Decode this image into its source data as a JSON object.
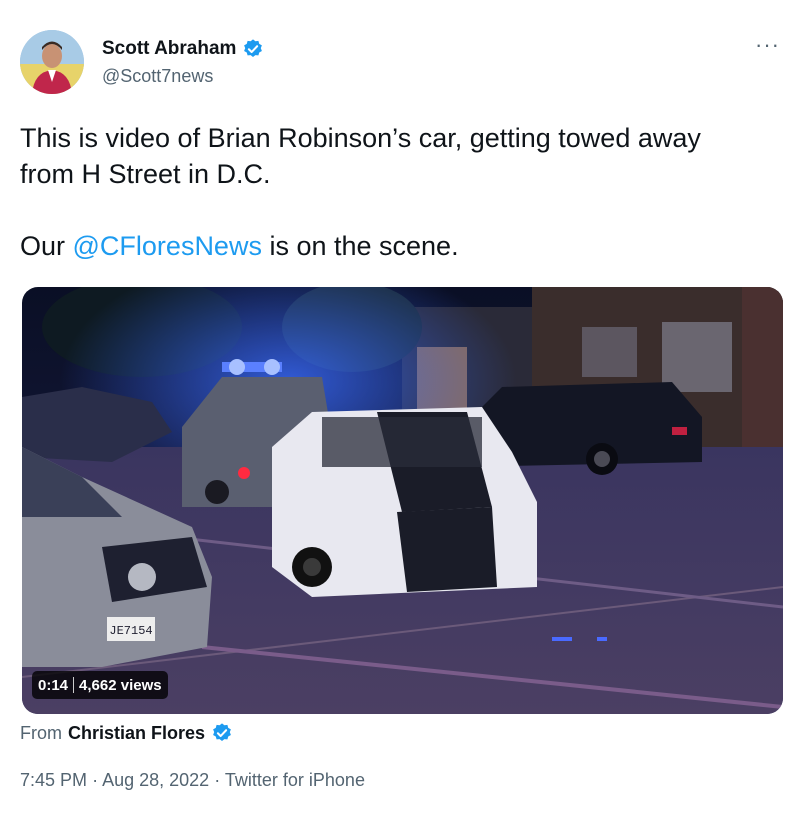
{
  "author": {
    "name": "Scott Abraham",
    "handle": "@Scott7news"
  },
  "more_icon": "more-horizontal-icon",
  "tweet": {
    "line1": "This is video of Brian Robinson’s car, getting towed away from H Street in D.C.",
    "line2_prefix": "Our ",
    "line2_mention": "@CFloresNews",
    "line2_suffix": " is on the scene."
  },
  "media": {
    "duration": "0:14",
    "views": "4,662 views",
    "plate_text": "JE7154"
  },
  "source": {
    "from_label": "From",
    "name": "Christian Flores"
  },
  "meta": {
    "time": "7:45 PM",
    "dot1": "·",
    "date": "Aug 28, 2022",
    "dot2": "·",
    "client": "Twitter for iPhone"
  },
  "colors": {
    "accent": "#1d9bf0",
    "text_primary": "#0f1419",
    "text_secondary": "#536471"
  }
}
